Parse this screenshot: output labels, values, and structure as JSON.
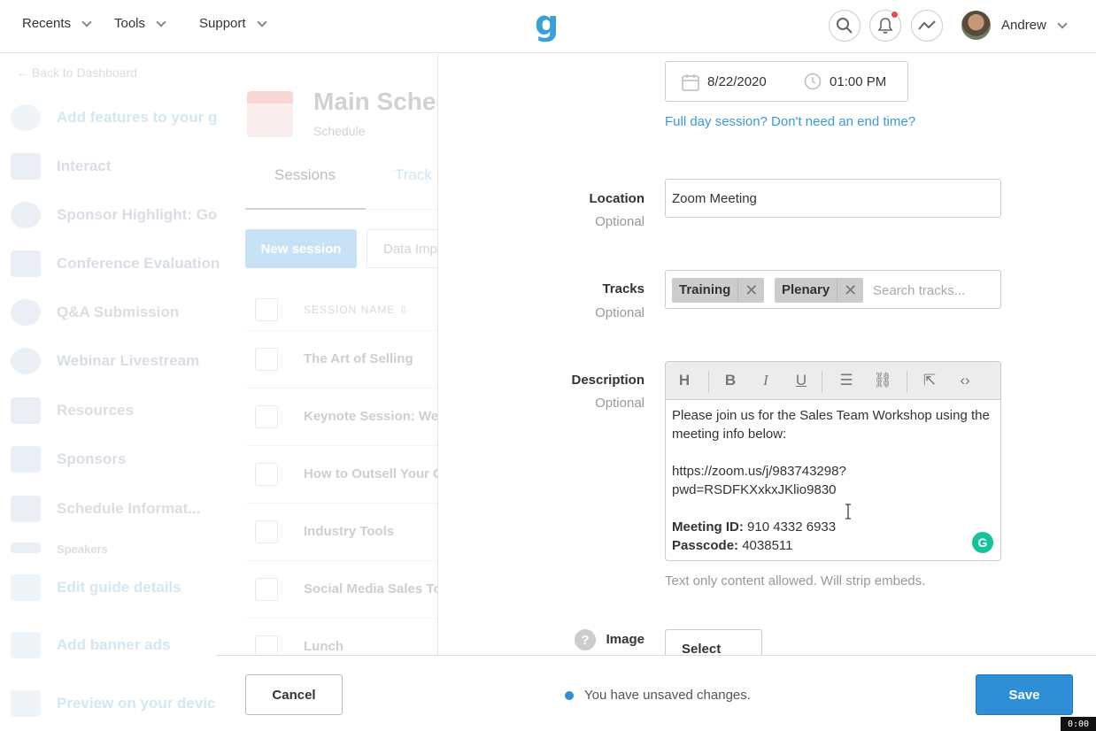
{
  "topbar": {
    "nav": [
      {
        "label": "Recents"
      },
      {
        "label": "Tools"
      },
      {
        "label": "Support"
      }
    ],
    "logo": "g",
    "user_name": "Andrew"
  },
  "sidebar": {
    "back_label": "← Back to Dashboard",
    "items": [
      {
        "label": "Add features to your g",
        "icon": "plus-circle-icon"
      },
      {
        "label": "Interact",
        "icon": "interact-icon"
      },
      {
        "label": "Sponsor Highlight: Go",
        "icon": "google-icon"
      },
      {
        "label": "Conference Evaluation",
        "icon": "chat-icon"
      },
      {
        "label": "Q&A Submission",
        "icon": "question-icon"
      },
      {
        "label": "Webinar Livestream",
        "icon": "youtube-icon"
      },
      {
        "label": "Resources",
        "icon": "folder-icon"
      },
      {
        "label": "Sponsors",
        "icon": "star-icon"
      },
      {
        "label": "Schedule Informat...",
        "icon": "calendar-icon"
      },
      {
        "label": "Speakers",
        "icon": "person-icon"
      },
      {
        "label": "Edit guide details",
        "icon": "gear-icon"
      },
      {
        "label": "Add banner ads",
        "icon": "phone-icon"
      },
      {
        "label": "Preview on your devic",
        "icon": "preview-icon"
      }
    ]
  },
  "main": {
    "title": "Main Sched",
    "subtitle": "Schedule",
    "tabs": [
      {
        "label": "Sessions"
      },
      {
        "label": "Track"
      }
    ],
    "new_session_label": "New session",
    "data_import_label": "Data Imp",
    "column_header": "SESSION NAME",
    "rows": [
      {
        "name": "The Art of Selling"
      },
      {
        "name": "Keynote Session: Wel"
      },
      {
        "name": "How to Outsell Your C"
      },
      {
        "name": "Industry Tools"
      },
      {
        "name": "Social Media Sales To"
      },
      {
        "name": "Lunch"
      }
    ]
  },
  "panel": {
    "date": "8/22/2020",
    "time": "01:00 PM",
    "full_day_link": "Full day session? Don't need an end time?",
    "location": {
      "label": "Location",
      "optional": "Optional",
      "value": "Zoom Meeting"
    },
    "tracks": {
      "label": "Tracks",
      "optional": "Optional",
      "tags": [
        "Training",
        "Plenary"
      ],
      "placeholder": "Search tracks..."
    },
    "description": {
      "label": "Description",
      "optional": "Optional",
      "line1": "Please join us for the Sales Team Workshop using the meeting info below:",
      "url1": "https://zoom.us/j/983743298?",
      "url2": "pwd=RSDFKXxkxJKlio9830",
      "meeting_id_label": "Meeting ID:",
      "meeting_id": "910 4332 6933",
      "passcode_label": "Passcode:",
      "passcode": "4038511"
    },
    "hint": "Text only content allowed. Will strip embeds.",
    "image": {
      "label": "Image",
      "button": "Select File"
    }
  },
  "footer": {
    "cancel_label": "Cancel",
    "unsaved_message": "You have unsaved changes.",
    "save_label": "Save"
  },
  "clock": "0:00",
  "colors": {
    "accent": "#2f8fd6",
    "link": "#3a9ad9",
    "notification": "#e84a4a",
    "grammarly": "#15c39a"
  }
}
